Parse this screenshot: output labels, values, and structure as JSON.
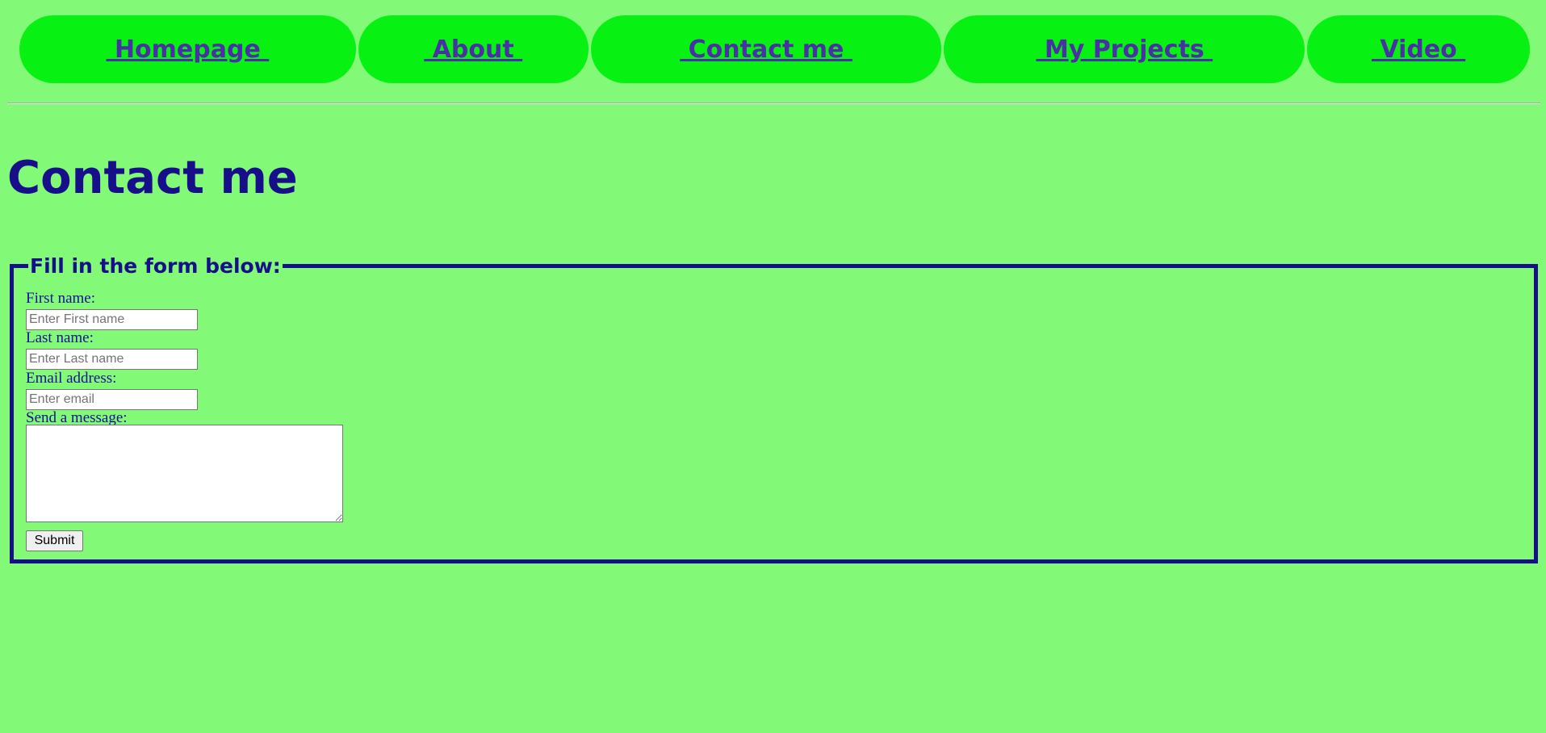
{
  "nav": {
    "items": [
      {
        "label": " Homepage "
      },
      {
        "label": " About "
      },
      {
        "label": " Contact me "
      },
      {
        "label": " My Projects "
      },
      {
        "label": " Video "
      }
    ]
  },
  "page": {
    "title": "Contact me"
  },
  "form": {
    "legend": "Fill in the form below:",
    "first_name": {
      "label": "First name:",
      "placeholder": "Enter First name",
      "value": ""
    },
    "last_name": {
      "label": "Last name:",
      "placeholder": "Enter Last name",
      "value": ""
    },
    "email": {
      "label": "Email address:",
      "placeholder": "Enter email",
      "value": ""
    },
    "message": {
      "label": "Send a message:",
      "value": ""
    },
    "submit_label": "Submit"
  },
  "colors": {
    "page_background": "#82f977",
    "nav_pill": "#07f213",
    "nav_link": "#4b2fa6",
    "heading": "#170e8a"
  }
}
